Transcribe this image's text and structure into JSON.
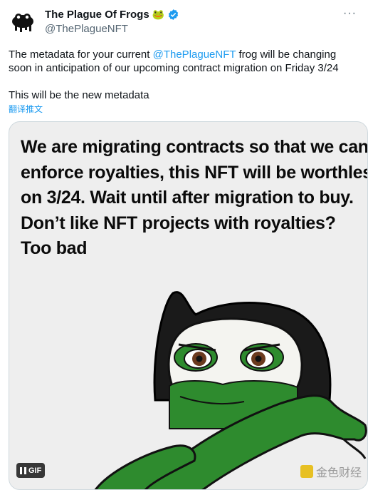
{
  "author": {
    "name": "The Plague Of Frogs",
    "name_emoji": "🐸",
    "verified_icon": "verified-badge-icon",
    "handle": "@ThePlagueNFT"
  },
  "more_icon": "more-options-icon",
  "tweet": {
    "line1_before": "The metadata for your current ",
    "mention": "@ThePlagueNFT",
    "line1_after": " frog will be changing",
    "line2": "soon in anticipation of our upcoming contract migration on Friday 3/24",
    "line3": "This will be the new metadata"
  },
  "translate_label": "翻译推文",
  "media": {
    "text_lines": [
      "We are migrating contracts so that we can",
      "enforce royalties, this NFT will be worthless",
      "on 3/24. Wait until after migration to buy.",
      "Don’t like NFT projects with royalties?",
      "Too bad"
    ],
    "gif_label": "GIF",
    "pause_icon": "pause-icon",
    "watermark": "金色财经"
  },
  "colors": {
    "accent": "#1d9bf0",
    "frog_green": "#2e8b2e",
    "hood": "#1a1a1a"
  }
}
